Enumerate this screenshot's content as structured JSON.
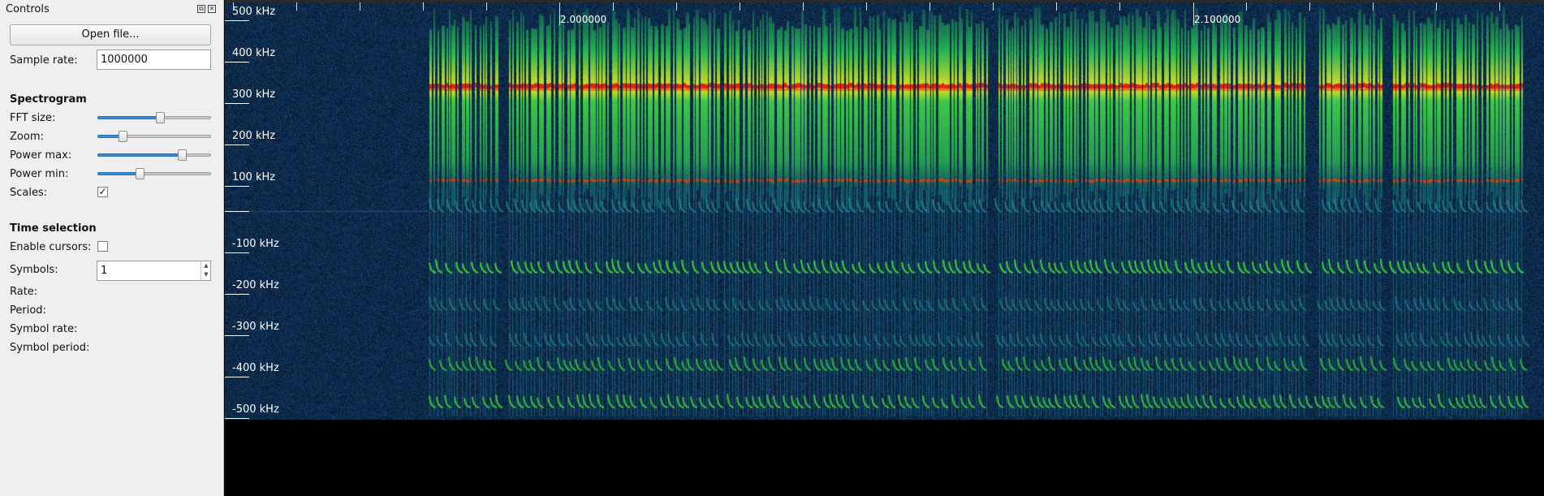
{
  "controls": {
    "title": "Controls",
    "float_icon": "⧉",
    "close_icon": "✕",
    "open_file_label": "Open file...",
    "sample_rate_label": "Sample rate:",
    "sample_rate_value": "1000000",
    "spectrogram_section": "Spectrogram",
    "fft_size_label": "FFT size:",
    "fft_size_level": 0.55,
    "zoom_label": "Zoom:",
    "zoom_level": 0.22,
    "power_max_label": "Power max:",
    "power_max_level": 0.74,
    "power_min_label": "Power min:",
    "power_min_level": 0.37,
    "scales_label": "Scales:",
    "scales_checked": "✓",
    "time_selection_section": "Time selection",
    "enable_cursors_label": "Enable cursors:",
    "symbols_label": "Symbols:",
    "symbols_value": "1",
    "rate_label": "Rate:",
    "period_label": "Period:",
    "symbol_rate_label": "Symbol rate:",
    "symbol_period_label": "Symbol period:"
  },
  "spectrogram": {
    "freq_axis": [
      "500 kHz",
      "400 kHz",
      "300 kHz",
      "200 kHz",
      "100 kHz",
      "-100 kHz",
      "-200 kHz",
      "-300 kHz",
      "-400 kHz",
      "-500 kHz"
    ],
    "time_axis": [
      "2.000000",
      "2.100000"
    ],
    "colors": {
      "background": "#0a1640",
      "signal_core": "#e52010",
      "signal_mid": "#e7e21a",
      "signal_outer": "#23b04a",
      "streak": "#1c7f8f"
    }
  }
}
